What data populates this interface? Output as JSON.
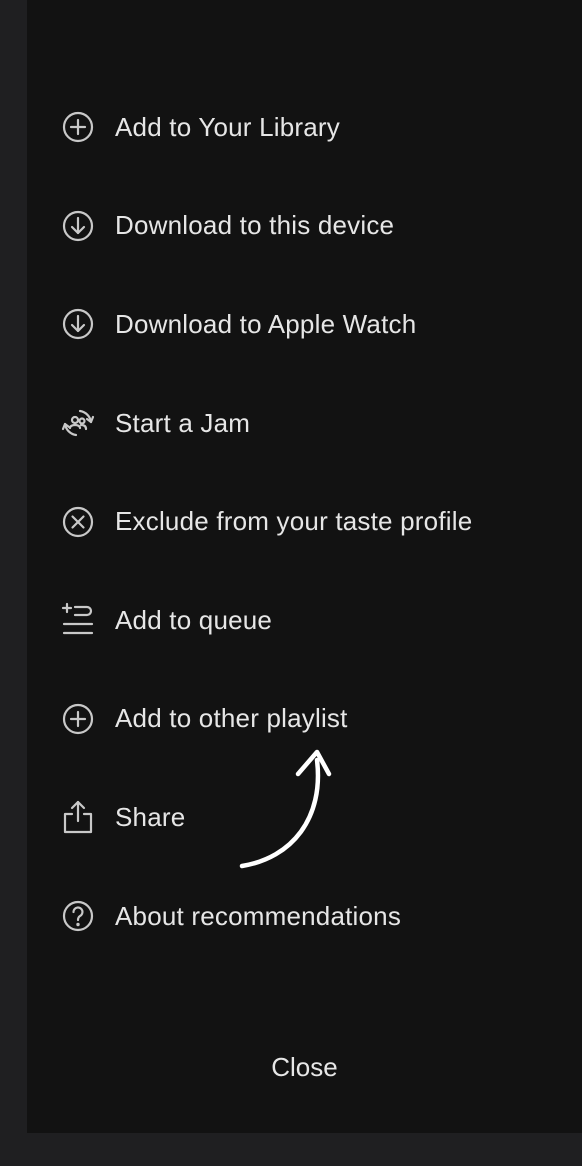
{
  "header": {
    "cut_text": ""
  },
  "menu": {
    "items": [
      {
        "label": "Add to Your Library",
        "icon": "plus-circle-icon"
      },
      {
        "label": "Download to this device",
        "icon": "download-circle-icon"
      },
      {
        "label": "Download to Apple Watch",
        "icon": "download-circle-icon"
      },
      {
        "label": "Start a Jam",
        "icon": "jam-icon"
      },
      {
        "label": "Exclude from your taste profile",
        "icon": "x-circle-icon"
      },
      {
        "label": "Add to queue",
        "icon": "queue-add-icon"
      },
      {
        "label": "Add to other playlist",
        "icon": "plus-circle-icon"
      },
      {
        "label": "Share",
        "icon": "share-icon"
      },
      {
        "label": "About recommendations",
        "icon": "question-circle-icon"
      }
    ]
  },
  "close_label": "Close",
  "colors": {
    "background": "#121212",
    "outer": "#1f1f21",
    "text": "#e6e6e6",
    "icon": "#b3b3b3",
    "annotation": "#ffffff"
  }
}
